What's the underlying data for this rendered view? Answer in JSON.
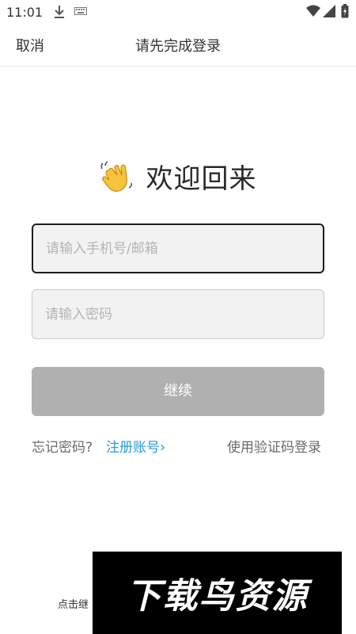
{
  "status_bar": {
    "time": "11:01",
    "icons": [
      "download-icon",
      "keyboard-icon",
      "wifi-icon",
      "signal-icon",
      "battery-icon"
    ]
  },
  "nav": {
    "cancel_label": "取消",
    "title": "请先完成登录"
  },
  "welcome": {
    "emoji_icon": "waving-hand-icon",
    "text": "欢迎回来"
  },
  "form": {
    "account_placeholder": "请输入手机号/邮箱",
    "account_value": "",
    "password_placeholder": "请输入密码",
    "password_value": "",
    "continue_label": "继续"
  },
  "links": {
    "forgot_label": "忘记密码?",
    "register_label": "注册账号",
    "register_chevron": "›",
    "sms_login_label": "使用验证码登录"
  },
  "footer": {
    "partial_text": "点击继"
  },
  "watermark": {
    "text": "下载鸟资源"
  },
  "colors": {
    "accent_link": "#2a9bd6",
    "button_disabled": "#b0b0b0",
    "input_bg": "#f2f2f2"
  }
}
